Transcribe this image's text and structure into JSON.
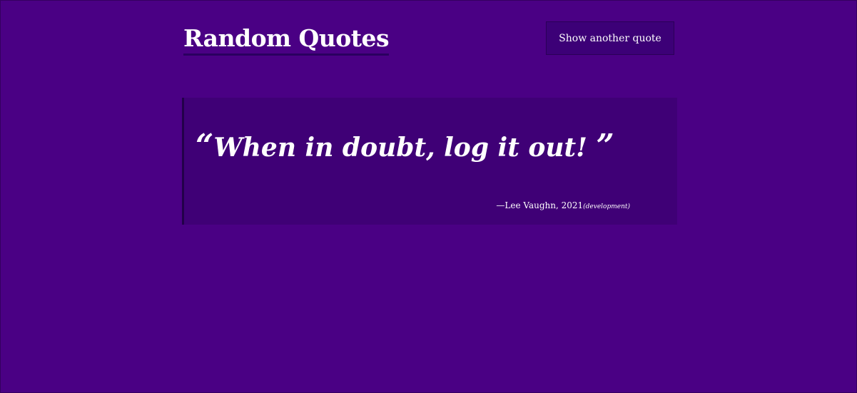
{
  "header": {
    "title": "Random Quotes",
    "button_label": "Show another quote"
  },
  "quote": {
    "open_mark": "“",
    "text": "When in doubt, log it out!",
    "close_mark": "”",
    "attribution": "—Lee Vaughn, 2021",
    "category": "(development)"
  },
  "colors": {
    "background": "#4a0084",
    "quote_box": "#3f0076",
    "button": "#3c0077",
    "accent_border": "#22004a",
    "text": "#ffffff"
  }
}
